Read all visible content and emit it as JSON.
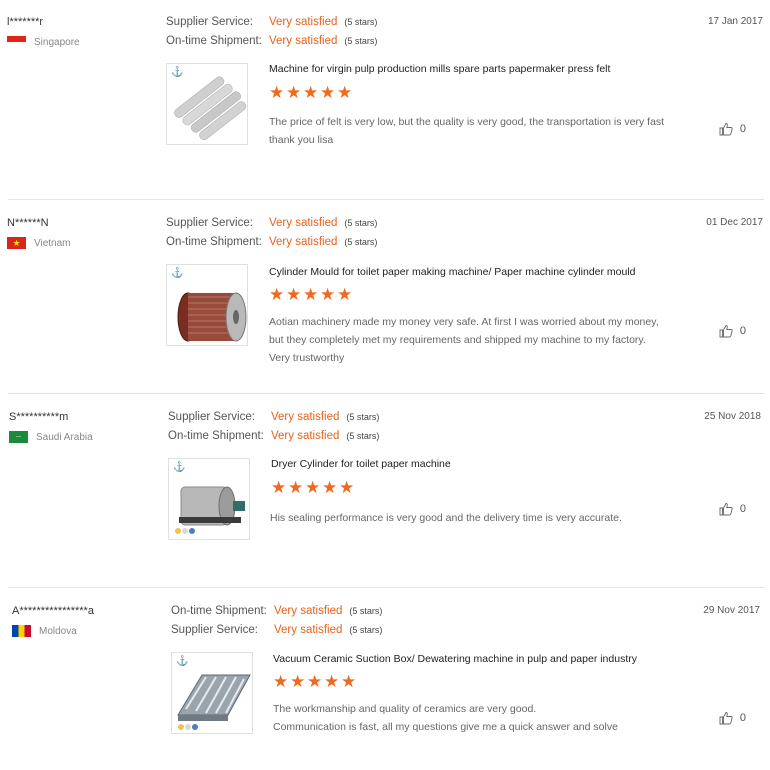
{
  "reviews": [
    {
      "buyer": "l*******r",
      "country": "Singapore",
      "date": "17 Jan 2017",
      "ratings": [
        {
          "label": "Supplier Service:",
          "value": "Very satisfied",
          "stars": "(5 stars)"
        },
        {
          "label": "On-time Shipment:",
          "value": "Very satisfied",
          "stars": "(5 stars)"
        }
      ],
      "product": "Machine for virgin pulp production mills spare parts papermaker press felt",
      "rating_stars": 5,
      "comment": [
        "The price of felt is very low, but the quality is very good, the transportation is very fast",
        "thank you lisa"
      ],
      "likes": "0"
    },
    {
      "buyer": "N******N",
      "country": "Vietnam",
      "date": "01 Dec 2017",
      "ratings": [
        {
          "label": "Supplier Service:",
          "value": "Very satisfied",
          "stars": "(5 stars)"
        },
        {
          "label": "On-time Shipment:",
          "value": "Very satisfied",
          "stars": "(5 stars)"
        }
      ],
      "product": "Cylinder Mould for toilet paper making machine/ Paper machine cylinder mould",
      "rating_stars": 5,
      "comment": [
        "Aotian machinery made my money very safe. At first I was worried about my money,",
        "but they completely met my requirements and shipped my machine to my factory.",
        "Very trustworthy"
      ],
      "likes": "0"
    },
    {
      "buyer": "S**********m",
      "country": "Saudi Arabia",
      "date": "25 Nov 2018",
      "ratings": [
        {
          "label": "Supplier Service:",
          "value": "Very satisfied",
          "stars": "(5 stars)"
        },
        {
          "label": "On-time Shipment:",
          "value": "Very satisfied",
          "stars": "(5 stars)"
        }
      ],
      "product": "Dryer Cylinder for toilet paper machine",
      "rating_stars": 5,
      "comment": [
        "His sealing performance is very good and the delivery time is very accurate."
      ],
      "likes": "0"
    },
    {
      "buyer": "A****************a",
      "country": "Moldova",
      "date": "29 Nov 2017",
      "ratings": [
        {
          "label": "On-time Shipment:",
          "value": "Very satisfied",
          "stars": "(5 stars)"
        },
        {
          "label": "Supplier Service:",
          "value": "Very satisfied",
          "stars": "(5 stars)"
        }
      ],
      "product": "Vacuum Ceramic Suction Box/ Dewatering machine in pulp and paper industry",
      "rating_stars": 5,
      "comment": [
        "The workmanship and quality of ceramics are very good.",
        "Communication is fast, all my questions give me a quick answer and solve"
      ],
      "likes": "0"
    }
  ],
  "colors": {
    "accent": "#e8621c",
    "star": "#f06a1e",
    "separator": "#e3e3e3"
  },
  "icons": {
    "like": "thumbs-up-icon",
    "star": "star-icon",
    "flag": "country-flag-icon"
  }
}
